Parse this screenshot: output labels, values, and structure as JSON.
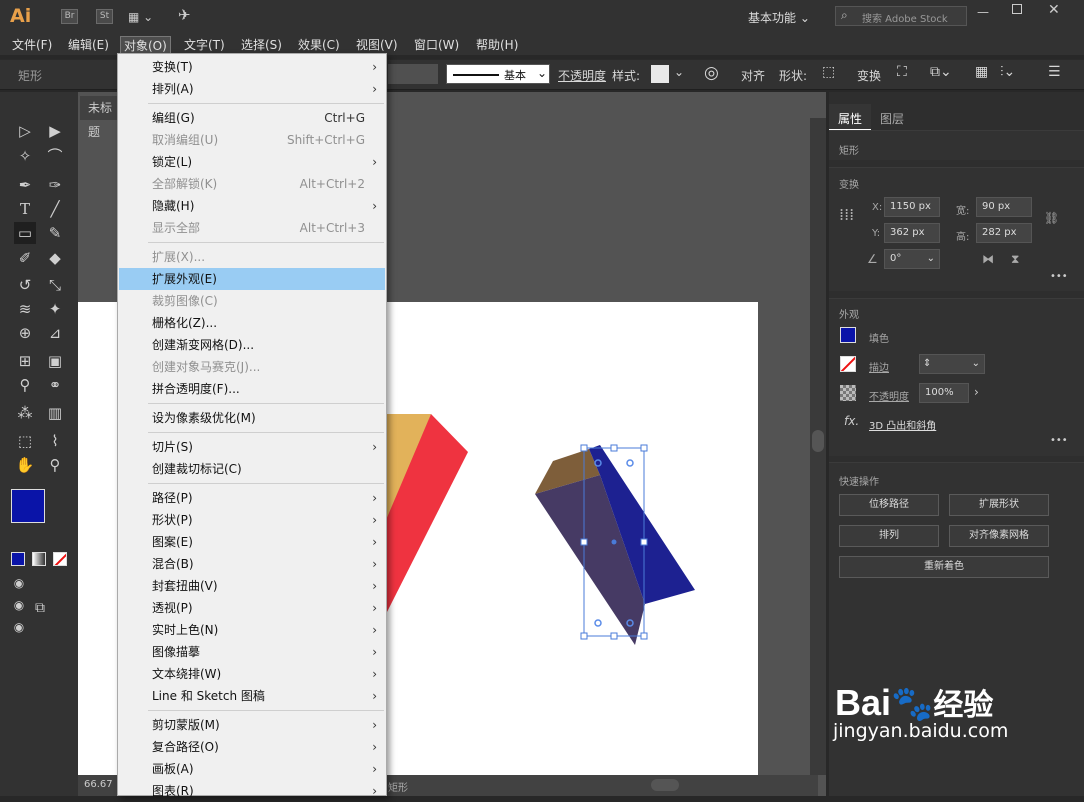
{
  "app": {
    "logo": "Ai",
    "bridge_label": "Br",
    "stock_label": "St",
    "workspace": "基本功能",
    "search_placeholder": "搜索 Adobe Stock"
  },
  "menubar": [
    "文件(F)",
    "编辑(E)",
    "对象(O)",
    "文字(T)",
    "选择(S)",
    "效果(C)",
    "视图(V)",
    "窗口(W)",
    "帮助(H)"
  ],
  "control_bar": {
    "shape_label": "矩形",
    "stroke_style": "基本",
    "opacity_label": "不透明度",
    "style_label": "样式:",
    "align_label": "对齐",
    "shape_prop_label": "形状:",
    "transform_label": "变换"
  },
  "document": {
    "tab_label": "未标题",
    "zoom": "66.67",
    "status_label": "矩形"
  },
  "object_menu": [
    {
      "label": "变换(T)",
      "submenu": true
    },
    {
      "label": "排列(A)",
      "submenu": true
    },
    {
      "sep": true
    },
    {
      "label": "编组(G)",
      "shortcut": "Ctrl+G"
    },
    {
      "label": "取消编组(U)",
      "shortcut": "Shift+Ctrl+G",
      "disabled": true
    },
    {
      "label": "锁定(L)",
      "submenu": true
    },
    {
      "label": "全部解锁(K)",
      "shortcut": "Alt+Ctrl+2",
      "disabled": true
    },
    {
      "label": "隐藏(H)",
      "submenu": true
    },
    {
      "label": "显示全部",
      "shortcut": "Alt+Ctrl+3",
      "disabled": true
    },
    {
      "sep": true
    },
    {
      "label": "扩展(X)...",
      "disabled": true
    },
    {
      "label": "扩展外观(E)",
      "highlighted": true
    },
    {
      "label": "裁剪图像(C)",
      "disabled": true
    },
    {
      "label": "栅格化(Z)..."
    },
    {
      "label": "创建渐变网格(D)..."
    },
    {
      "label": "创建对象马赛克(J)...",
      "disabled": true
    },
    {
      "label": "拼合透明度(F)..."
    },
    {
      "sep": true
    },
    {
      "label": "设为像素级优化(M)"
    },
    {
      "sep": true
    },
    {
      "label": "切片(S)",
      "submenu": true
    },
    {
      "label": "创建裁切标记(C)"
    },
    {
      "sep": true
    },
    {
      "label": "路径(P)",
      "submenu": true
    },
    {
      "label": "形状(P)",
      "submenu": true
    },
    {
      "label": "图案(E)",
      "submenu": true
    },
    {
      "label": "混合(B)",
      "submenu": true
    },
    {
      "label": "封套扭曲(V)",
      "submenu": true
    },
    {
      "label": "透视(P)",
      "submenu": true
    },
    {
      "label": "实时上色(N)",
      "submenu": true
    },
    {
      "label": "图像描摹",
      "submenu": true
    },
    {
      "label": "文本绕排(W)",
      "submenu": true
    },
    {
      "label": "Line 和 Sketch 图稿",
      "submenu": true
    },
    {
      "sep": true
    },
    {
      "label": "剪切蒙版(M)",
      "submenu": true
    },
    {
      "label": "复合路径(O)",
      "submenu": true
    },
    {
      "label": "画板(A)",
      "submenu": true
    },
    {
      "label": "图表(R)",
      "submenu": true
    }
  ],
  "panel": {
    "tabs": [
      "属性",
      "图层"
    ],
    "object_type": "矩形",
    "transform_title": "变换",
    "x_label": "X:",
    "x_value": "1150 px",
    "y_label": "Y:",
    "y_value": "362 px",
    "w_label": "宽:",
    "w_value": "90 px",
    "h_label": "高:",
    "h_value": "282 px",
    "angle_value": "0°",
    "appearance_title": "外观",
    "fill_label": "填色",
    "stroke_label": "描边",
    "opacity_label": "不透明度",
    "opacity_value": "100%",
    "fx_label": "fx.",
    "effect_label": "3D 凸出和斜角",
    "quick_title": "快速操作",
    "buttons": [
      "位移路径",
      "扩展形状",
      "排列",
      "对齐像素网格",
      "重新着色"
    ],
    "more": "•••"
  },
  "colors": {
    "fill": "#0a14a8",
    "accent_highlight": "#99ccf3",
    "arrow": "#e8383d"
  },
  "watermark": {
    "brand_left": "Bai",
    "brand_right": "经验",
    "url": "jingyan.baidu.com"
  }
}
